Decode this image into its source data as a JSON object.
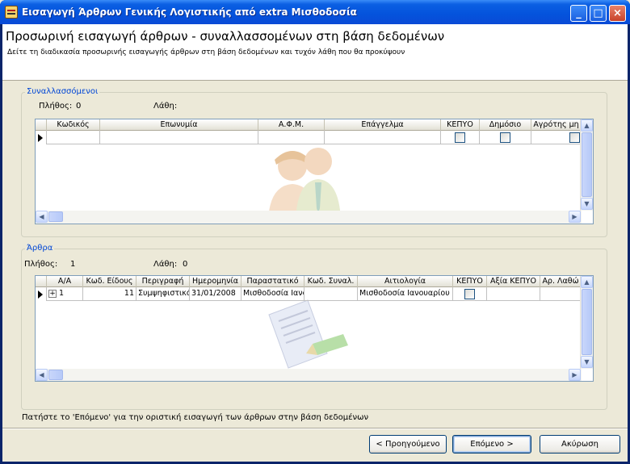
{
  "window": {
    "title": "Εισαγωγή Άρθρων Γενικής Λογιστικής από extra Μισθοδοσία"
  },
  "header": {
    "title": "Προσωρινή εισαγωγή άρθρων - συναλλασσομένων στη βάση δεδομένων",
    "subtitle": "Δείτε τη διαδικασία προσωρινής εισαγωγής άρθρων στη βάση δεδομένων και τυχόν λάθη που θα προκύψουν"
  },
  "counterparties": {
    "label": "Συναλλασσόμενοι",
    "count_label": "Πλήθος:",
    "count": "0",
    "errors_label": "Λάθη:",
    "errors": "",
    "columns": [
      "Κωδικός",
      "Επωνυμία",
      "Α.Φ.Μ.",
      "Επάγγελμα",
      "ΚΕΠΥΟ",
      "Δημόσιο",
      "Αγρότης μη"
    ],
    "row": {
      "kepyo": false,
      "dimosio": false,
      "agrotis": false
    }
  },
  "entries": {
    "label": "Άρθρα",
    "count_label": "Πλήθος:",
    "count": "1",
    "errors_label": "Λάθη:",
    "errors": "0",
    "columns": [
      "Α/Α",
      "Κωδ. Είδους",
      "Περιγραφή",
      "Ημερομηνία",
      "Παραστατικό",
      "Κωδ. Συναλ.",
      "Αιτιολογία",
      "ΚΕΠΥΟ",
      "Αξία ΚΕΠΥΟ",
      "Αρ. Λαθώ"
    ],
    "rows": [
      {
        "expand": "+",
        "aa": "1",
        "kod_eidous": "11",
        "perigrafi": "Συμψηφιστικό",
        "imerominia": "31/01/2008",
        "parastatiko": "Μισθοδοσία Ιανο",
        "kod_synal": "",
        "aitiologia": "Μισθοδοσία Ιανουαρίου",
        "kepyo": false,
        "axia_kepyo": "",
        "ar_lathon": ""
      }
    ]
  },
  "footer": {
    "instruction": "Πατήστε το 'Επόμενο' για την οριστική εισαγωγή των άρθρων στην βάση δεδομένων"
  },
  "buttons": {
    "back": "< Προηγούμενο",
    "next": "Επόμενο >",
    "cancel": "Ακύρωση"
  },
  "icons": {
    "app": "ledger-icon",
    "people_watermark": "people-icon",
    "document_watermark": "document-pen-icon"
  }
}
